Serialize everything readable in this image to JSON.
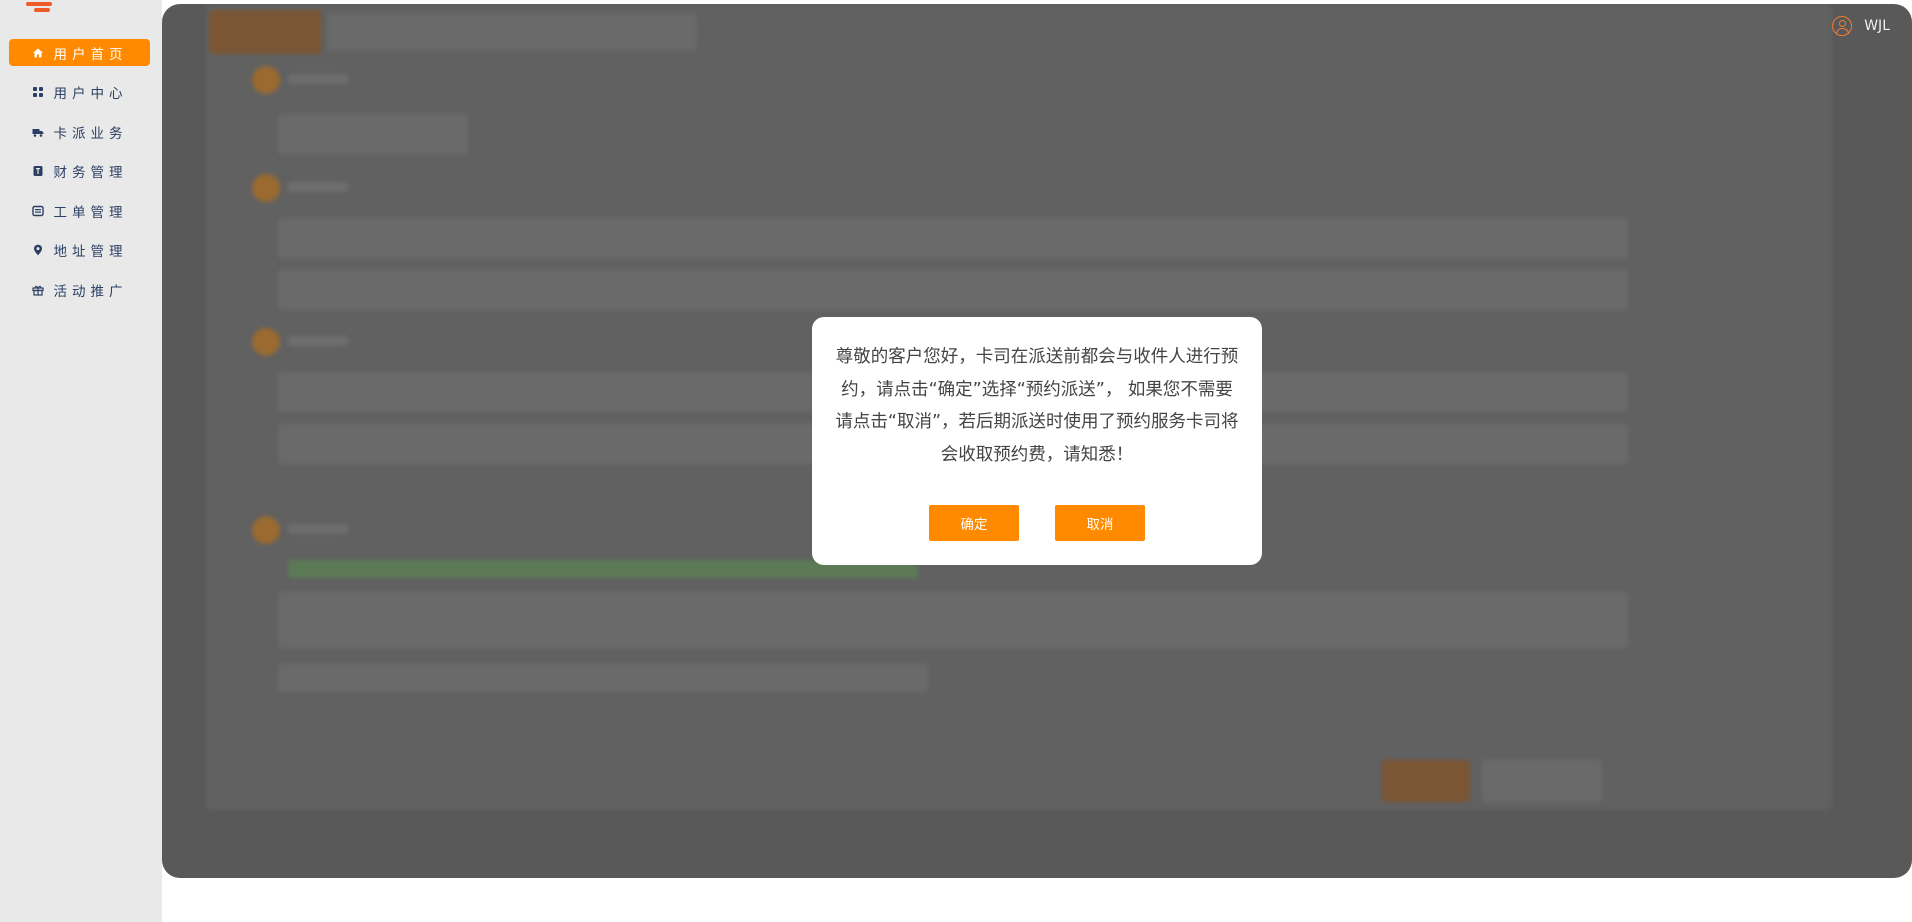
{
  "sidebar": {
    "items": [
      {
        "label": "用户首页",
        "icon": "home-icon",
        "active": true
      },
      {
        "label": "用户中心",
        "icon": "grid-icon",
        "active": false
      },
      {
        "label": "卡派业务",
        "icon": "truck-icon",
        "active": false
      },
      {
        "label": "财务管理",
        "icon": "finance-icon",
        "active": false
      },
      {
        "label": "工单管理",
        "icon": "ticket-icon",
        "active": false
      },
      {
        "label": "地址管理",
        "icon": "location-icon",
        "active": false
      },
      {
        "label": "活动推广",
        "icon": "gift-icon",
        "active": false
      }
    ]
  },
  "header": {
    "username": "WJL"
  },
  "modal": {
    "message": "尊敬的客户您好，卡司在派送前都会与收件人进行预约，请点击“确定”选择“预约派送”， 如果您不需要请点击“取消”，若后期派送时使用了预约服务卡司将会收取预约费，请知悉！",
    "confirm_label": "确定",
    "cancel_label": "取消"
  },
  "colors": {
    "accent": "#ff8a00",
    "overlay": "#595959",
    "sidebar_bg": "#e9e9e9",
    "menu_text": "#2a3f63"
  }
}
